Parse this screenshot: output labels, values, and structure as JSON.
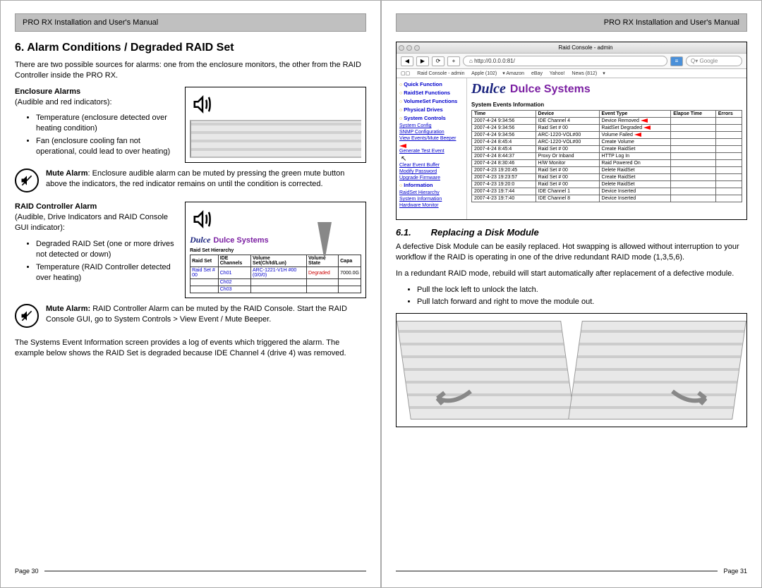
{
  "header": {
    "title": "PRO RX Installation and User's Manual"
  },
  "left": {
    "section_num": "6.",
    "section_title": "Alarm Conditions / Degraded RAID Set",
    "intro": "There are two possible sources for alarms: one from the enclosure monitors, the other from the RAID Controller inside the PRO RX.",
    "enclosure_heading": "Enclosure Alarms",
    "enclosure_sub": "(Audible and red indicators):",
    "enclosure_bullets": [
      "Temperature (enclosure detected over heating condition)",
      "Fan (enclosure cooling fan not operational, could lead to over heating)"
    ],
    "mute1_label": "Mute Alarm",
    "mute1_text": ": Enclosure audible alarm can be muted by pressing the green mute button above the indicators, the red indicator remains on until the condition is corrected.",
    "raid_heading": "RAID Controller Alarm",
    "raid_sub": "(Audible, Drive Indicators and RAID Console GUI indicator):",
    "raid_bullets": [
      "Degraded RAID Set (one or more drives not detected or down)",
      "Temperature (RAID Controller detected over heating)"
    ],
    "mute2_label": "Mute Alarm:",
    "mute2_text": " RAID Controller Alarm can be muted by the RAID Console.  Start the RAID Console GUI, go to System Controls > View Event / Mute Beeper.",
    "event_info": "The Systems Event Information screen provides a log of events which triggered the alarm.  The example below shows the RAID Set is degraded because IDE Channel 4 (drive 4) was removed.",
    "rc_small": {
      "logo": "Dulce",
      "logo2": "Dulce Systems",
      "caption": "Raid Set Hierarchy",
      "cols": [
        "Raid Set",
        "IDE Channels",
        "Volume Set(Ch/Id/Lun)",
        "Volume State",
        "Capa"
      ],
      "rows": [
        [
          "Raid Set # 00",
          "Ch01",
          "ARC-1221-V1H #00 (0/0/0)",
          "Degraded",
          "7000.0G"
        ],
        [
          "",
          "Ch02",
          "",
          "",
          ""
        ],
        [
          "",
          "Ch03",
          "",
          "",
          ""
        ]
      ]
    },
    "page_num": "Page 30"
  },
  "right": {
    "browser": {
      "title": "Raid Console - admin",
      "url": "http://0.0.0.0:81/",
      "search_placeholder": "Google",
      "bookmarks": [
        "Raid Console - admin",
        "Apple (102)",
        "Amazon",
        "eBay",
        "Yahoo!",
        "News (812)"
      ],
      "sidebar_groups": [
        {
          "name": "Quick Function",
          "items": []
        },
        {
          "name": "RaidSet Functions",
          "items": []
        },
        {
          "name": "VolumeSet Functions",
          "items": []
        },
        {
          "name": "Physical Drives",
          "items": []
        },
        {
          "name": "System Controls",
          "items": [
            "System Config",
            "SNMP Configuration",
            "View Events/Mute Beeper",
            "Generate Test Event",
            "Clear Event Buffer",
            "Modify Password",
            "Upgrade Firmware"
          ]
        },
        {
          "name": "Information",
          "items": [
            "RaidSet Hierarchy",
            "System Information",
            "Hardware Monitor"
          ]
        }
      ],
      "logo": "Dulce",
      "logo2": "Dulce Systems",
      "events_caption": "System Events Information",
      "events_cols": [
        "Time",
        "Device",
        "Event Type",
        "Elapse Time",
        "Errors"
      ],
      "events_rows": [
        [
          "2007-4-24 9:34:56",
          "IDE Channel 4",
          "Device Removed",
          "",
          ""
        ],
        [
          "2007-4-24 9:34:56",
          "Raid Set # 00",
          "RaidSet Degraded",
          "",
          ""
        ],
        [
          "2007-4-24 9:34:56",
          "ARC-1220-VOL#00",
          "Volume Failed",
          "",
          ""
        ],
        [
          "2007-4-24 8:45:4",
          "ARC-1220-VOL#00",
          "Create Volume",
          "",
          ""
        ],
        [
          "2007-4-24 8:45:4",
          "Raid Set # 00",
          "Create RaidSet",
          "",
          ""
        ],
        [
          "2007-4-24 8:44:37",
          "Proxy Or Inband",
          "HTTP Log In",
          "",
          ""
        ],
        [
          "2007-4-24 8:30:46",
          "H/W Monitor",
          "Raid Powered On",
          "",
          ""
        ],
        [
          "2007-4-23 19:20:45",
          "Raid Set # 00",
          "Delete RaidSet",
          "",
          ""
        ],
        [
          "2007-4-23 19:23:57",
          "Raid Set # 00",
          "Create RaidSet",
          "",
          ""
        ],
        [
          "2007-4-23 19:20:0",
          "Raid Set # 00",
          "Delete RaidSet",
          "",
          ""
        ],
        [
          "2007-4-23 19:7:44",
          "IDE Channel 1",
          "Device Inserted",
          "",
          ""
        ],
        [
          "2007-4-23 19:7:40",
          "IDE Channel 8",
          "Device Inserted",
          "",
          ""
        ]
      ]
    },
    "sub_num": "6.1.",
    "sub_title": "Replacing a Disk Module",
    "p1": "A defective Disk Module can be easily replaced.  Hot swapping is allowed without interruption to your workflow if the RAID is operating in one of the drive redundant RAID mode (1,3,5,6).",
    "p2": "In a redundant RAID mode, rebuild will start automatically after replacement of a defective module.",
    "bullets": [
      "Pull the lock left to unlock the latch.",
      "Pull latch forward and right to move the module out."
    ],
    "page_num": "Page 31"
  }
}
